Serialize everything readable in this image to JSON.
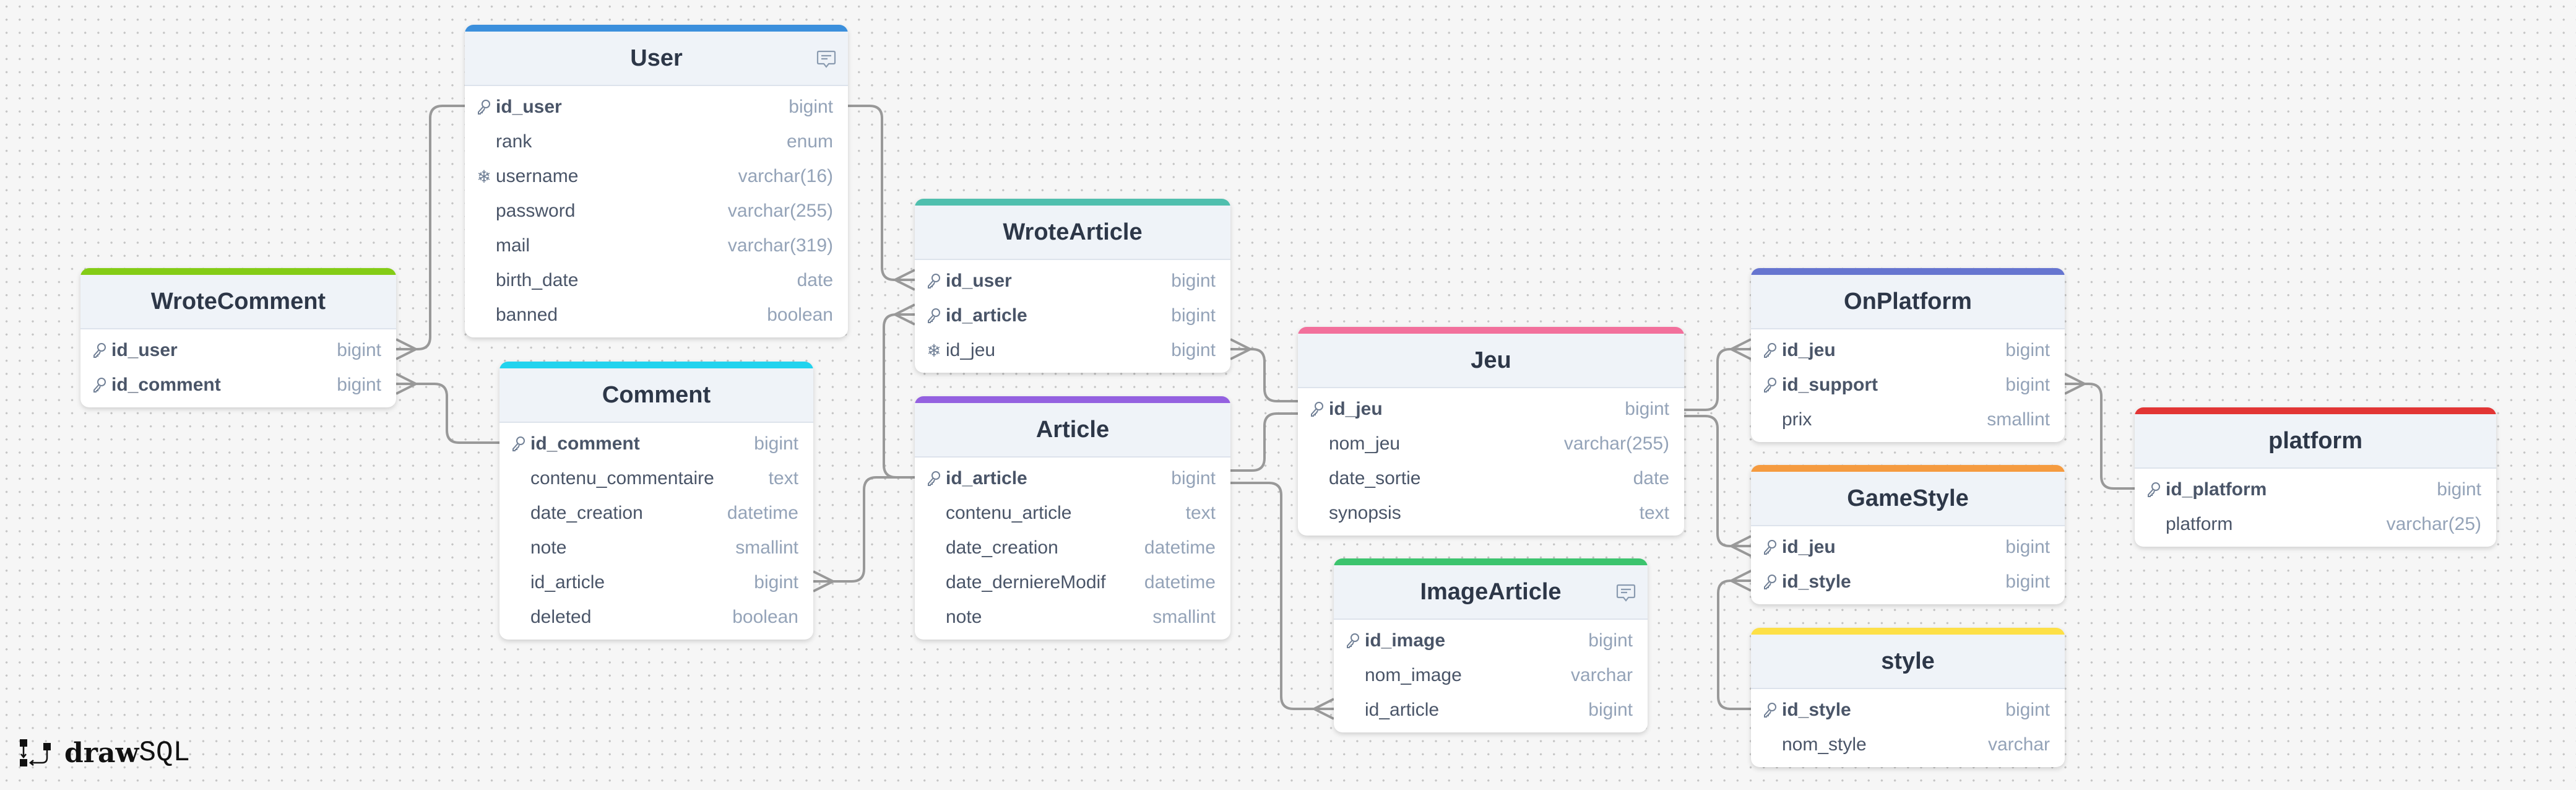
{
  "logo": {
    "part1": "draw",
    "part2": "SQL"
  },
  "tables": [
    {
      "id": "user",
      "name": "User",
      "color": "#3b8fdc",
      "comment_icon": true,
      "columns": [
        {
          "name": "id_user",
          "type": "bigint",
          "icon": "key-icon",
          "bold": true
        },
        {
          "name": "rank",
          "type": "enum"
        },
        {
          "name": "username",
          "type": "varchar(16)",
          "icon": "snowflake-icon"
        },
        {
          "name": "password",
          "type": "varchar(255)"
        },
        {
          "name": "mail",
          "type": "varchar(319)"
        },
        {
          "name": "birth_date",
          "type": "date"
        },
        {
          "name": "banned",
          "type": "boolean"
        }
      ]
    },
    {
      "id": "wrotecomment",
      "name": "WroteComment",
      "color": "#84cc16",
      "columns": [
        {
          "name": "id_user",
          "type": "bigint",
          "icon": "key-icon",
          "bold": true
        },
        {
          "name": "id_comment",
          "type": "bigint",
          "icon": "key-icon",
          "bold": true
        }
      ]
    },
    {
      "id": "comment",
      "name": "Comment",
      "color": "#22d3ee",
      "columns": [
        {
          "name": "id_comment",
          "type": "bigint",
          "icon": "key-icon",
          "bold": true
        },
        {
          "name": "contenu_commentaire",
          "type": "text"
        },
        {
          "name": "date_creation",
          "type": "datetime"
        },
        {
          "name": "note",
          "type": "smallint"
        },
        {
          "name": "id_article",
          "type": "bigint"
        },
        {
          "name": "deleted",
          "type": "boolean"
        }
      ]
    },
    {
      "id": "wrotearticle",
      "name": "WroteArticle",
      "color": "#4fbfae",
      "columns": [
        {
          "name": "id_user",
          "type": "bigint",
          "icon": "key-icon",
          "bold": true
        },
        {
          "name": "id_article",
          "type": "bigint",
          "icon": "key-icon",
          "bold": true
        },
        {
          "name": "id_jeu",
          "type": "bigint",
          "icon": "snowflake-icon"
        }
      ]
    },
    {
      "id": "article",
      "name": "Article",
      "color": "#9461e0",
      "columns": [
        {
          "name": "id_article",
          "type": "bigint",
          "icon": "key-icon",
          "bold": true
        },
        {
          "name": "contenu_article",
          "type": "text"
        },
        {
          "name": "date_creation",
          "type": "datetime"
        },
        {
          "name": "date_derniereModif",
          "type": "datetime"
        },
        {
          "name": "note",
          "type": "smallint"
        }
      ]
    },
    {
      "id": "jeu",
      "name": "Jeu",
      "color": "#f2709c",
      "columns": [
        {
          "name": "id_jeu",
          "type": "bigint",
          "icon": "key-icon",
          "bold": true
        },
        {
          "name": "nom_jeu",
          "type": "varchar(255)"
        },
        {
          "name": "date_sortie",
          "type": "date"
        },
        {
          "name": "synopsis",
          "type": "text"
        }
      ]
    },
    {
      "id": "imagearticle",
      "name": "ImageArticle",
      "color": "#3cc46e",
      "comment_icon": true,
      "columns": [
        {
          "name": "id_image",
          "type": "bigint",
          "icon": "key-icon",
          "bold": true
        },
        {
          "name": "nom_image",
          "type": "varchar"
        },
        {
          "name": "id_article",
          "type": "bigint"
        }
      ]
    },
    {
      "id": "onplatform",
      "name": "OnPlatform",
      "color": "#6675d0",
      "columns": [
        {
          "name": "id_jeu",
          "type": "bigint",
          "icon": "key-icon",
          "bold": true
        },
        {
          "name": "id_support",
          "type": "bigint",
          "icon": "key-icon",
          "bold": true
        },
        {
          "name": "prix",
          "type": "smallint"
        }
      ]
    },
    {
      "id": "gamestyle",
      "name": "GameStyle",
      "color": "#f59b40",
      "columns": [
        {
          "name": "id_jeu",
          "type": "bigint",
          "icon": "key-icon",
          "bold": true
        },
        {
          "name": "id_style",
          "type": "bigint",
          "icon": "key-icon",
          "bold": true
        }
      ]
    },
    {
      "id": "style",
      "name": "style",
      "color": "#fde047",
      "columns": [
        {
          "name": "id_style",
          "type": "bigint",
          "icon": "key-icon",
          "bold": true
        },
        {
          "name": "nom_style",
          "type": "varchar"
        }
      ]
    },
    {
      "id": "platform",
      "name": "platform",
      "color": "#e23535",
      "columns": [
        {
          "name": "id_platform",
          "type": "bigint",
          "icon": "key-icon",
          "bold": true
        },
        {
          "name": "platform",
          "type": "varchar(25)"
        }
      ]
    }
  ],
  "connector_color": "#999999"
}
